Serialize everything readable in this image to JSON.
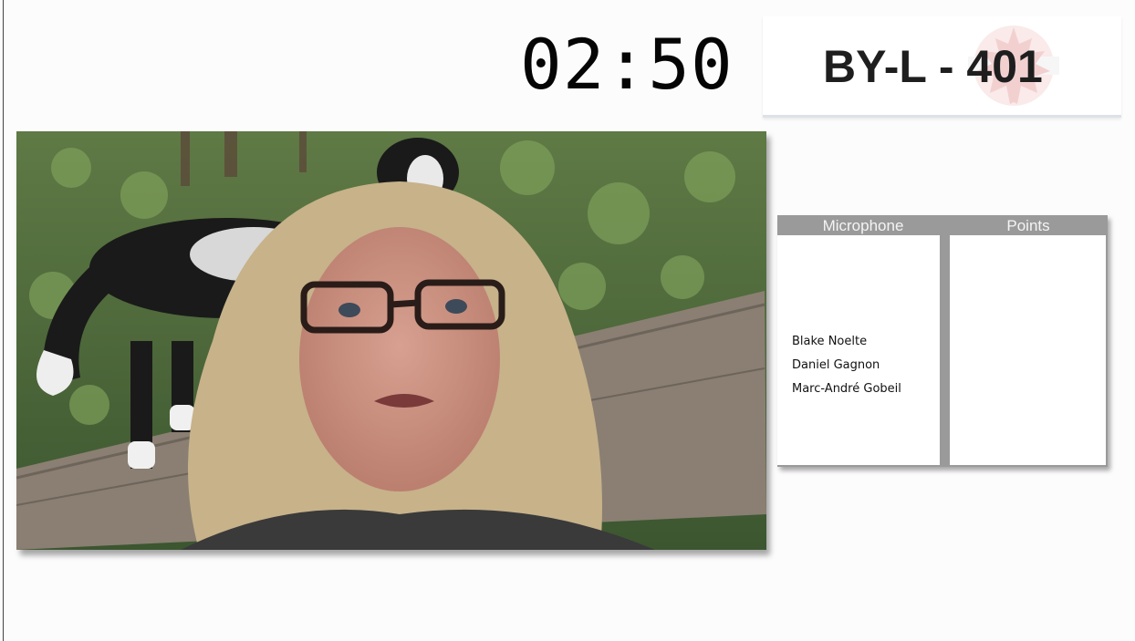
{
  "timer": {
    "text": "02:50"
  },
  "header": {
    "code": "BY-L - 401",
    "logo_icon": "maple-leaf-logo-icon"
  },
  "video": {
    "content_icon": "participant-video-feed"
  },
  "panel": {
    "columns": [
      {
        "label": "Microphone"
      },
      {
        "label": "Points"
      }
    ],
    "speakers": [
      {
        "name": "Blake Noelte"
      },
      {
        "name": "Daniel Gagnon"
      },
      {
        "name": "Marc-André Gobeil"
      }
    ],
    "points": []
  },
  "colors": {
    "table_header": "#9a9a9a",
    "logo": "#e8a3a3",
    "header_underline": "#dde2e8"
  }
}
